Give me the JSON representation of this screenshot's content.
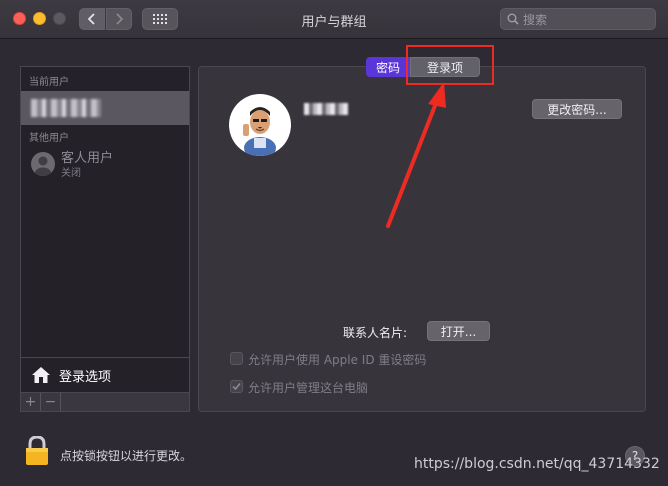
{
  "window": {
    "title": "用户与群组"
  },
  "toolbar": {
    "search_placeholder": "搜索"
  },
  "sidebar": {
    "current_user_label": "当前用户",
    "other_users_label": "其他用户",
    "guest_name": "客人用户",
    "guest_status": "关闭",
    "login_options_label": "登录选项",
    "add_label": "+",
    "remove_label": "−"
  },
  "tabs": {
    "password": "密码",
    "login_items": "登录项"
  },
  "main": {
    "change_password": "更改密码...",
    "contact_card_label": "联系人名片:",
    "open_button": "打开...",
    "allow_apple_id_reset": "允许用户使用 Apple ID 重设密码",
    "allow_admin": "允许用户管理这台电脑",
    "allow_apple_id_reset_checked": false,
    "allow_admin_checked": true
  },
  "footer": {
    "lock_text": "点按锁按钮以进行更改。",
    "help": "?"
  },
  "watermark": "https://blog.csdn.net/qq_43714332",
  "colors": {
    "accent_tab": "#5a36d8",
    "annotation": "#ee2b22"
  }
}
